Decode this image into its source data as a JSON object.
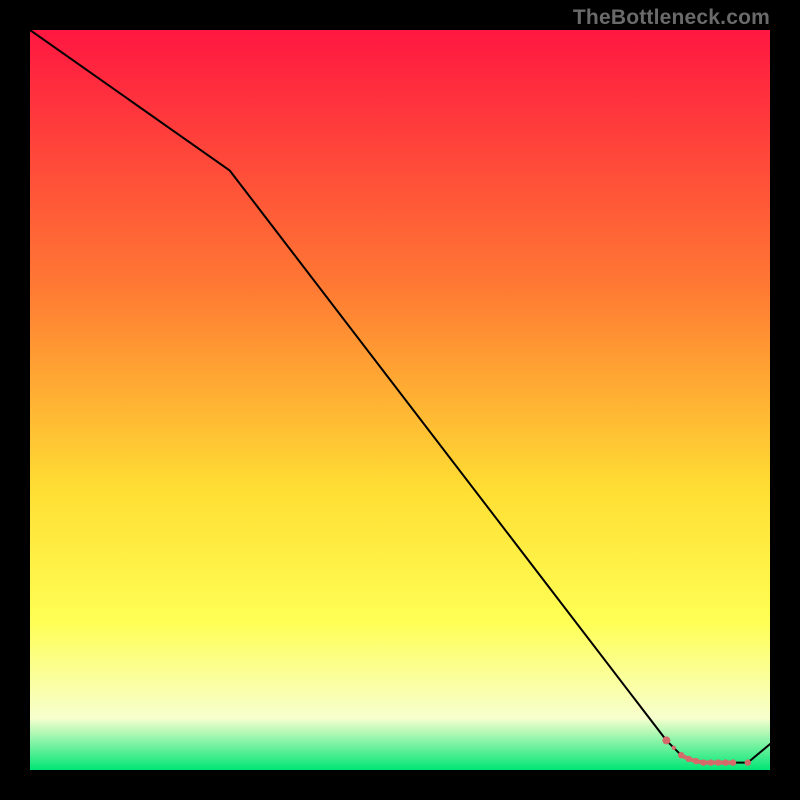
{
  "watermark": "TheBottleneck.com",
  "colors": {
    "frame": "#000000",
    "grad_top": "#ff1741",
    "grad_mid_upper": "#ff7a33",
    "grad_mid": "#ffde33",
    "grad_mid_lower": "#ffff55",
    "grad_pale": "#f7ffce",
    "grad_bottom": "#00e676",
    "curve": "#000000",
    "markers": "#d46a6a"
  },
  "chart_data": {
    "type": "line",
    "title": "",
    "xlabel": "",
    "ylabel": "",
    "xlim": [
      0,
      100
    ],
    "ylim": [
      0,
      100
    ],
    "series": [
      {
        "name": "bottleneck-curve",
        "x": [
          0,
          27,
          86,
          88,
          90,
          91,
          92,
          93,
          94,
          95,
          97,
          100
        ],
        "y": [
          100,
          81,
          4,
          2,
          1.2,
          1.0,
          1.0,
          1.0,
          1.0,
          1.0,
          1.0,
          3.5
        ]
      }
    ],
    "markers": {
      "name": "highlight-segment",
      "x": [
        86,
        88,
        89,
        90,
        91,
        92,
        93,
        94,
        95
      ],
      "y": [
        4,
        2,
        1.5,
        1.2,
        1.0,
        1.0,
        1.0,
        1.0,
        1.0
      ]
    },
    "gradient_stops": [
      {
        "offset": 0.0,
        "color_key": "grad_top"
      },
      {
        "offset": 0.35,
        "color_key": "grad_mid_upper"
      },
      {
        "offset": 0.62,
        "color_key": "grad_mid"
      },
      {
        "offset": 0.8,
        "color_key": "grad_mid_lower"
      },
      {
        "offset": 0.93,
        "color_key": "grad_pale"
      },
      {
        "offset": 1.0,
        "color_key": "grad_bottom"
      }
    ]
  }
}
